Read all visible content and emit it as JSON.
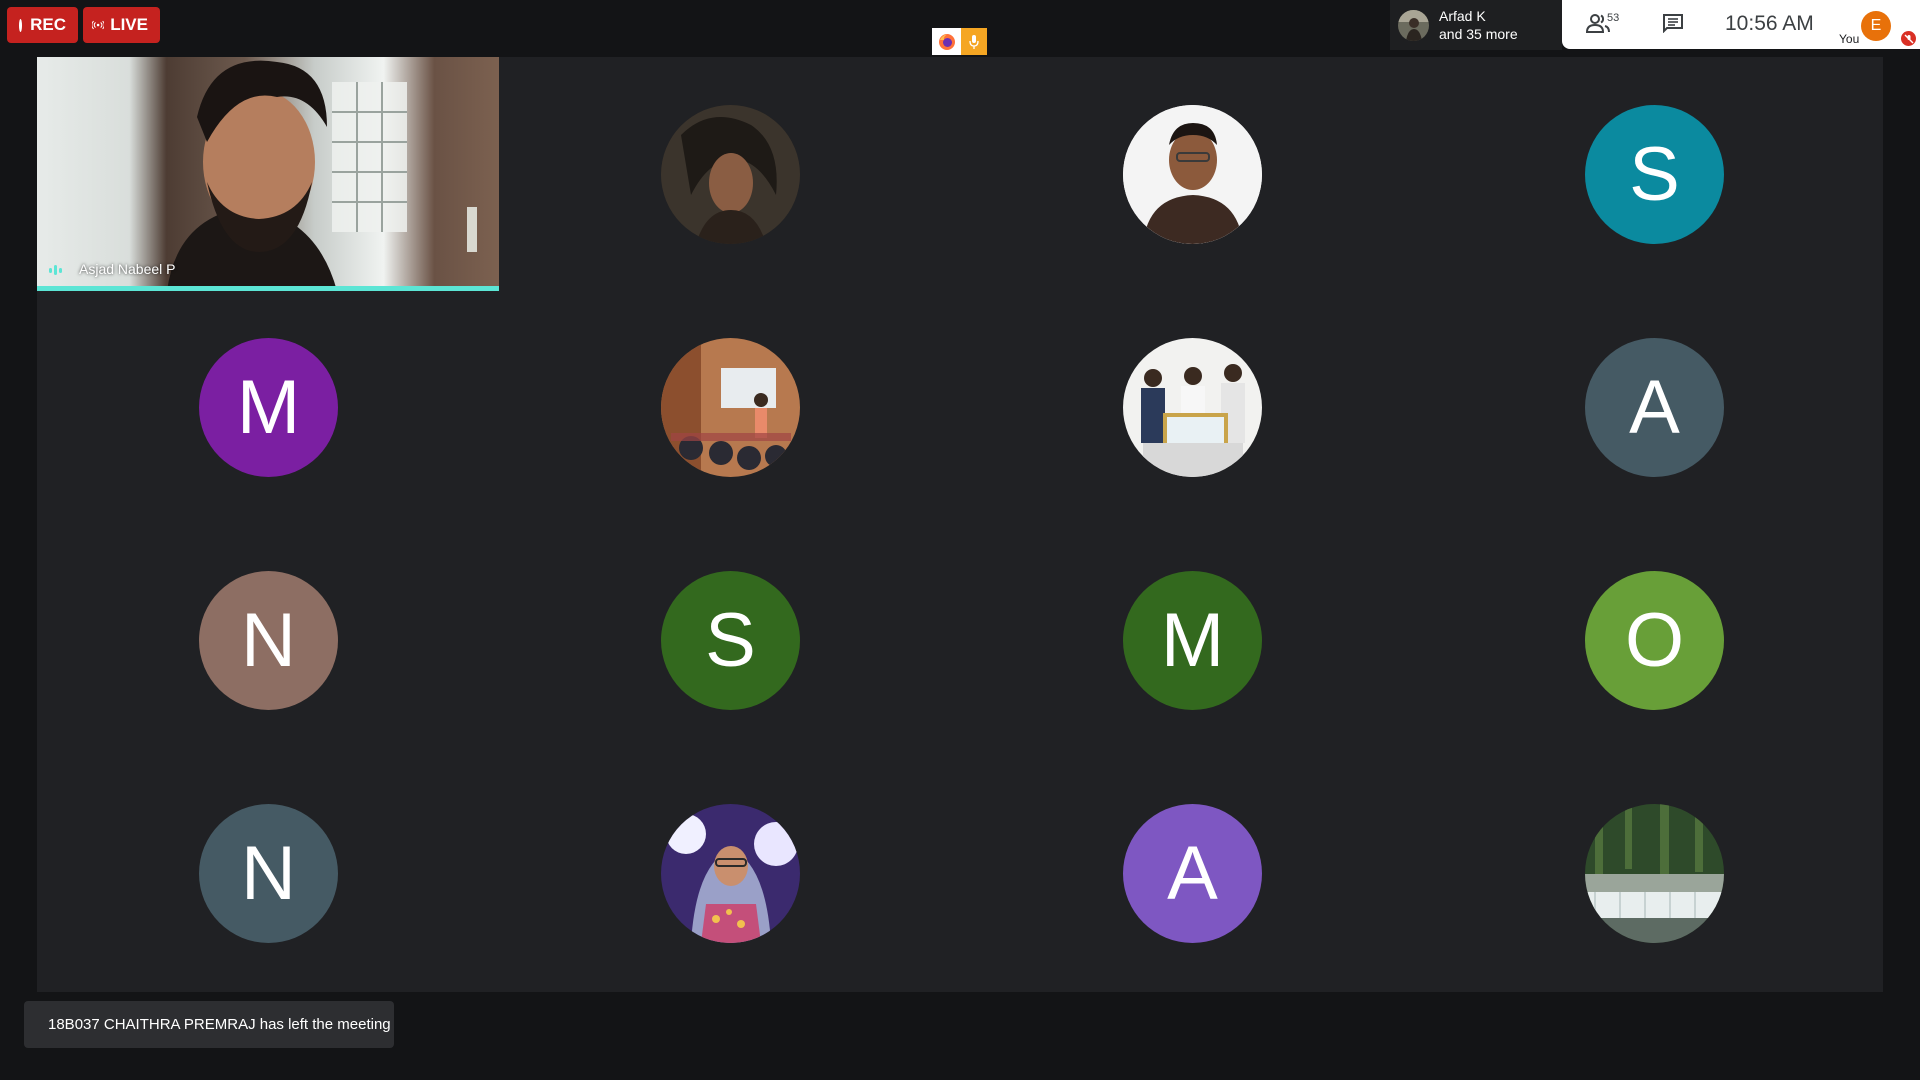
{
  "recording": {
    "rec_label": "REC",
    "live_label": "LIVE",
    "rec_color": "#c5221f"
  },
  "presenter_chip": {
    "name": "Arfad K",
    "more": "and 35 more"
  },
  "top_bar": {
    "people_count": "53",
    "time": "10:56 AM",
    "self_initial": "E",
    "self_label": "You"
  },
  "speaker": {
    "name": "Asjad Nabeel P",
    "active_color": "#5ce5d5"
  },
  "participants": [
    {
      "initial": "",
      "photo": "portrait-dark"
    },
    {
      "initial": "",
      "photo": "portrait-man"
    },
    {
      "initial": "S",
      "color": "#0b8a9f"
    },
    {
      "initial": "M",
      "color": "#7b1fa2"
    },
    {
      "initial": "",
      "photo": "classroom"
    },
    {
      "initial": "",
      "photo": "award"
    },
    {
      "initial": "A",
      "color": "#455a64"
    },
    {
      "initial": "N",
      "color": "#8d6e63"
    },
    {
      "initial": "S",
      "color": "#33691e"
    },
    {
      "initial": "M",
      "color": "#33691e"
    },
    {
      "initial": "O",
      "color": "#689f38"
    },
    {
      "initial": "N",
      "color": "#455a64"
    },
    {
      "initial": "",
      "photo": "hijab-portrait"
    },
    {
      "initial": "A",
      "color": "#7e57c2"
    },
    {
      "initial": "",
      "photo": "waterfall"
    }
  ],
  "toast": {
    "message": "18B037 CHAITHRA PREMRAJ has left the meeting"
  }
}
